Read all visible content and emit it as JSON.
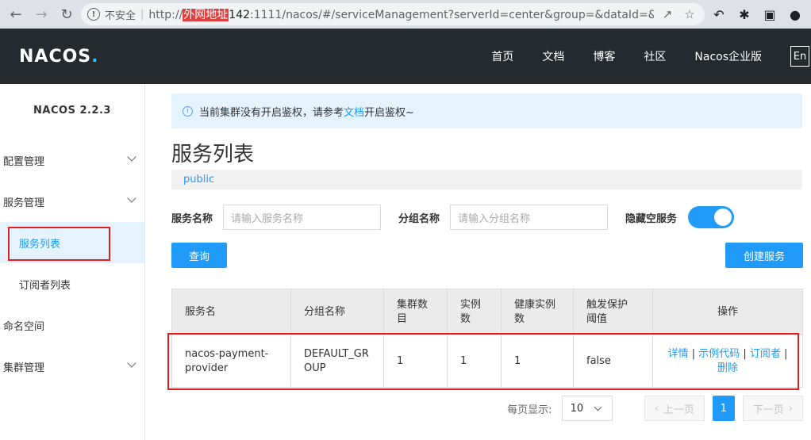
{
  "browser": {
    "insecure_label": "不安全",
    "url_prefix": "http://",
    "url_redacted": "外网地址",
    "url_host": "142",
    "url_rest": ":1111/nacos/#/serviceManagement?serverId=center&group=&dataId=&..."
  },
  "header": {
    "logo_main": "NAC",
    "logo_o": "O",
    "logo_tail": "S",
    "logo_dot": ".",
    "nav": [
      "首页",
      "文档",
      "博客",
      "社区",
      "Nacos企业版"
    ],
    "lang": "En"
  },
  "sidebar": {
    "version": "NACOS 2.2.3",
    "config_mgmt": "配置管理",
    "service_mgmt": "服务管理",
    "service_list": "服务列表",
    "subscriber_list": "订阅者列表",
    "namespace": "命名空间",
    "cluster_mgmt": "集群管理"
  },
  "main": {
    "notice_text": "当前集群没有开启鉴权，请参考",
    "notice_link": "文档",
    "notice_tail": "开启鉴权~",
    "title": "服务列表",
    "namespace": "public",
    "filter_service_label": "服务名称",
    "filter_service_placeholder": "请输入服务名称",
    "filter_group_label": "分组名称",
    "filter_group_placeholder": "请输入分组名称",
    "hide_empty_label": "隐藏空服务",
    "hide_empty_on": true,
    "query_btn": "查询",
    "create_btn": "创建服务"
  },
  "table": {
    "headers": [
      "服务名",
      "分组名称",
      "集群数目",
      "实例数",
      "健康实例数",
      "触发保护阈值",
      "操作"
    ],
    "rows": [
      {
        "service": "nacos-payment-provider",
        "group": "DEFAULT_GROUP",
        "clusters": "1",
        "instances": "1",
        "healthy": "1",
        "protect": "false",
        "op_detail": "详情",
        "op_sample": "示例代码",
        "op_subscriber": "订阅者",
        "op_delete": "删除"
      }
    ]
  },
  "pagination": {
    "page_size_label": "每页显示:",
    "page_size": "10",
    "prev": "上一页",
    "current": "1",
    "next": "下一页"
  },
  "colors": {
    "accent": "#209bfa",
    "header_bg": "#252a2f",
    "highlight_box": "#e02020"
  }
}
